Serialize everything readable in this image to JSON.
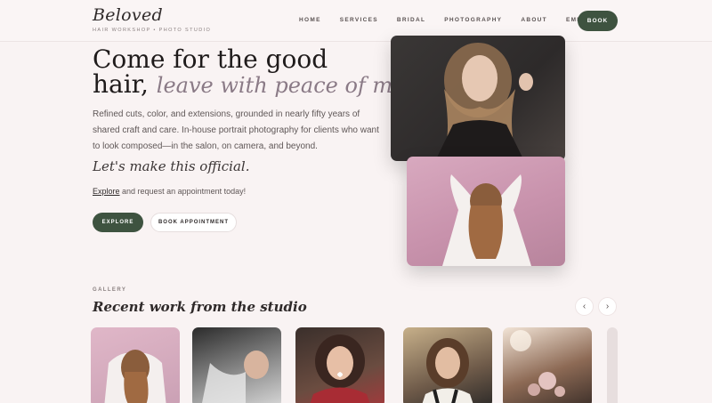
{
  "brand": {
    "logo": "Beloved",
    "tagline": "HAIR WORKSHOP • PHOTO STUDIO"
  },
  "nav": {
    "items": [
      "HOME",
      "SERVICES",
      "BRIDAL",
      "PHOTOGRAPHY",
      "ABOUT",
      "EMPLOYMENT"
    ],
    "book": "BOOK"
  },
  "hero": {
    "title_line1": "Come for the good",
    "title_line2_prefix": "hair,",
    "title_line2_accent": "leave with peace of mind.",
    "body": "Refined cuts, color, and extensions, grounded in nearly fifty years of shared craft and care. In-house portrait photography for clients who want to look composed—in the salon, on camera, and beyond.",
    "cta_line": "Let's make this official.",
    "explore_link": "Explore",
    "explore_text": "and request an appointment today!",
    "btn_explore": "EXPLORE",
    "btn_appointment": "BOOK APPOINTMENT"
  },
  "gallery": {
    "label": "GALLERY",
    "title": "Recent work from the studio",
    "prev": "‹",
    "next": "›"
  },
  "colors": {
    "accent": "#3e5340",
    "background": "#f9f3f3",
    "italic_accent": "#8a7a86"
  }
}
